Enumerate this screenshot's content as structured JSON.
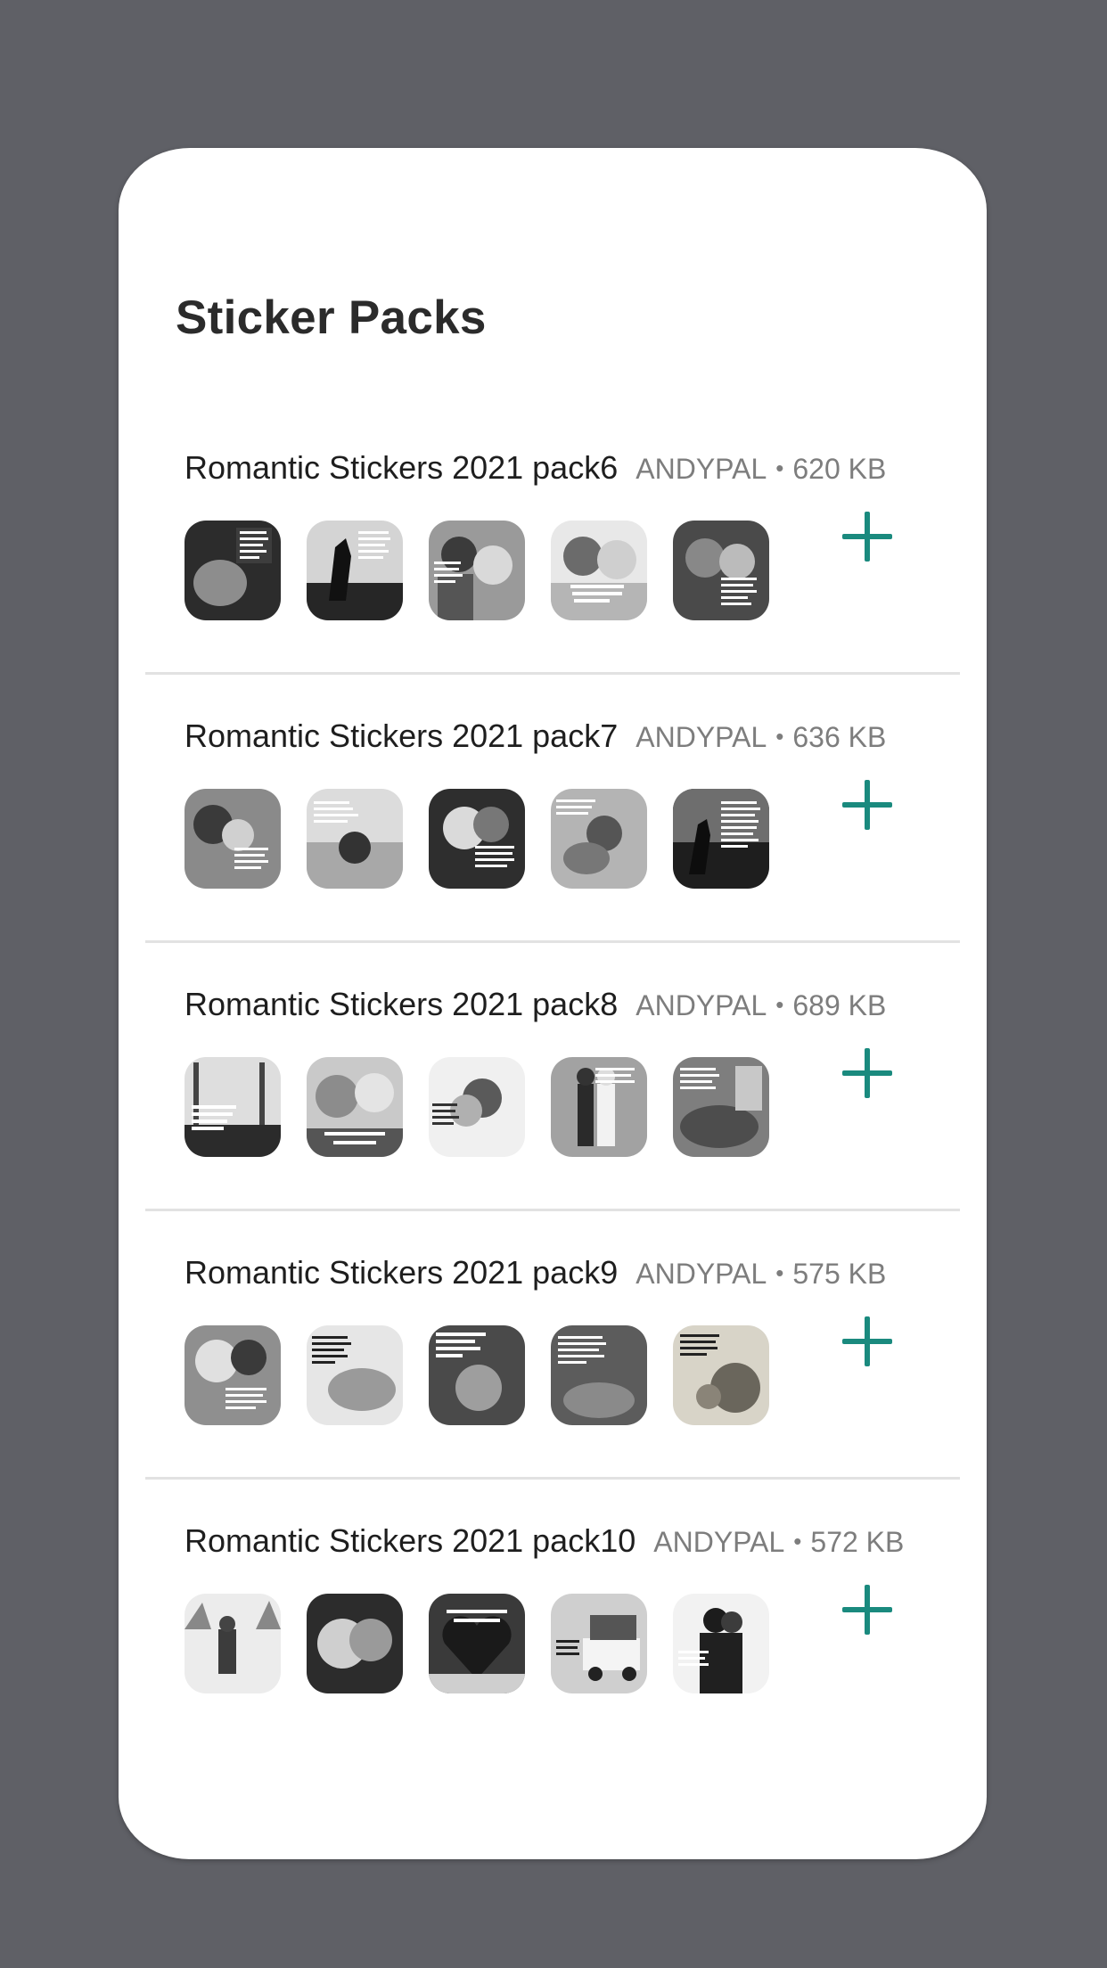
{
  "title": "Sticker Packs",
  "packs": [
    {
      "name": "Romantic Stickers 2021 pack6",
      "publisher": "ANDYPAL",
      "size": "620 KB"
    },
    {
      "name": "Romantic Stickers 2021 pack7",
      "publisher": "ANDYPAL",
      "size": "636 KB"
    },
    {
      "name": "Romantic Stickers 2021 pack8",
      "publisher": "ANDYPAL",
      "size": "689 KB"
    },
    {
      "name": "Romantic Stickers 2021 pack9",
      "publisher": "ANDYPAL",
      "size": "575 KB"
    },
    {
      "name": "Romantic Stickers 2021 pack10",
      "publisher": "ANDYPAL",
      "size": "572 KB"
    }
  ],
  "separator": "•",
  "icons": {
    "add": "plus-icon"
  },
  "colors": {
    "accent": "#1a8a7e",
    "background": "#5f6066",
    "card": "#ffffff"
  }
}
